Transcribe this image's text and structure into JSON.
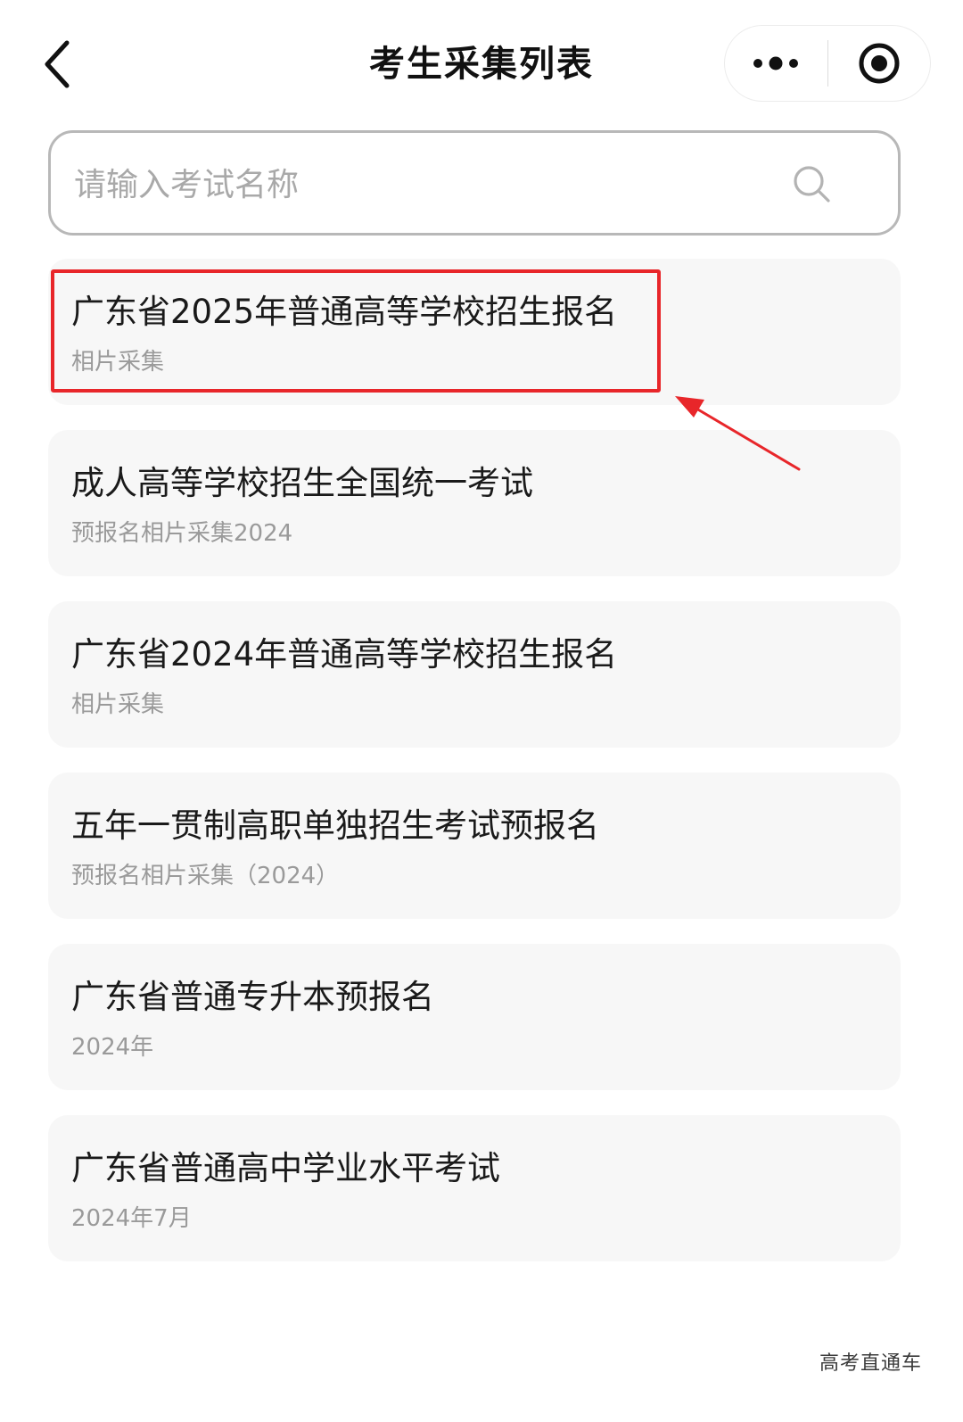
{
  "nav": {
    "title": "考生采集列表"
  },
  "search": {
    "placeholder": "请输入考试名称",
    "value": ""
  },
  "items": [
    {
      "title": "广东省2025年普通高等学校招生报名",
      "subtitle": "相片采集"
    },
    {
      "title": "成人高等学校招生全国统一考试",
      "subtitle": "预报名相片采集2024"
    },
    {
      "title": "广东省2024年普通高等学校招生报名",
      "subtitle": "相片采集"
    },
    {
      "title": "五年一贯制高职单独招生考试预报名",
      "subtitle": "预报名相片采集（2024）"
    },
    {
      "title": "广东省普通专升本预报名",
      "subtitle": "2024年"
    },
    {
      "title": "广东省普通高中学业水平考试",
      "subtitle": "2024年7月"
    }
  ],
  "watermark": "高考直通车",
  "colors": {
    "annotation": "#e8262a",
    "card_bg": "#f7f7f7",
    "subtitle": "#9a9a9a"
  }
}
